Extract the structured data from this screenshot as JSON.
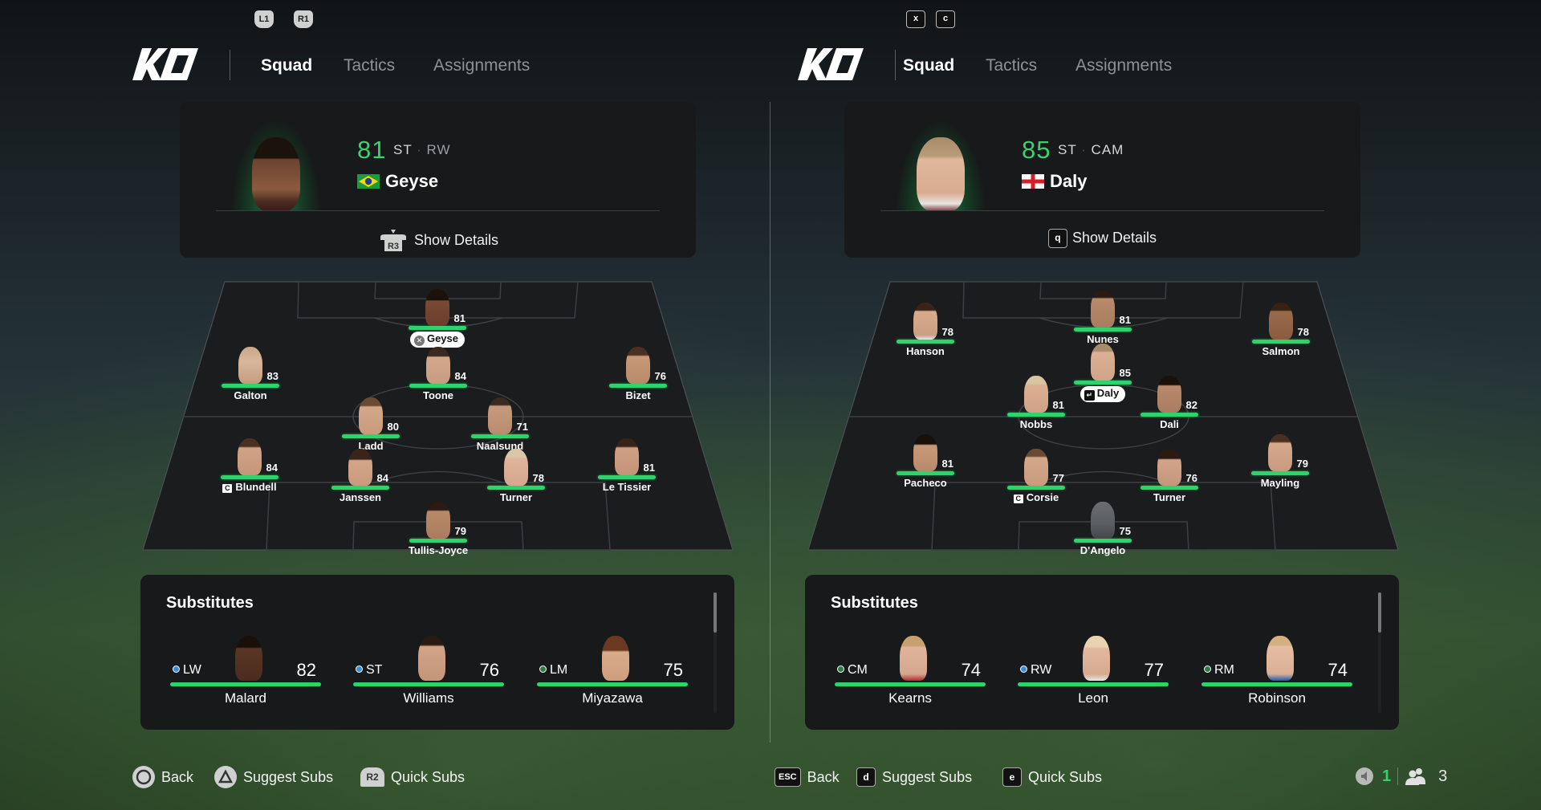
{
  "colors": {
    "accent_green": "#2ed36b",
    "rating_green": "#3bd16f",
    "panel_bg": "#17191a",
    "pitch_bg": "#1a1c1d",
    "dot_blue": "#3a8fd6",
    "dot_green": "#2f7d45"
  },
  "left": {
    "shoulder_buttons": [
      "L1",
      "R1"
    ],
    "logo": "KO",
    "tabs": [
      {
        "label": "Squad",
        "active": true
      },
      {
        "label": "Tactics",
        "active": false
      },
      {
        "label": "Assignments",
        "active": false
      }
    ],
    "selected_player": {
      "rating": "81",
      "positions": [
        "ST",
        "RW"
      ],
      "flag": "brazil-flag",
      "name": "Geyse",
      "details_button_icon": "R3",
      "details_label": "Show Details"
    },
    "pitch_players": [
      {
        "name": "Geyse",
        "rating": "81",
        "selected": true,
        "pill_icon": "cross-button-icon"
      },
      {
        "name": "Galton",
        "rating": "83"
      },
      {
        "name": "Toone",
        "rating": "84"
      },
      {
        "name": "Bizet",
        "rating": "76"
      },
      {
        "name": "Ladd",
        "rating": "80"
      },
      {
        "name": "Naalsund",
        "rating": "71"
      },
      {
        "name": "Blundell",
        "rating": "84",
        "captain": true
      },
      {
        "name": "Janssen",
        "rating": "84"
      },
      {
        "name": "Turner",
        "rating": "78"
      },
      {
        "name": "Le Tissier",
        "rating": "81"
      },
      {
        "name": "Tullis-Joyce",
        "rating": "79"
      }
    ],
    "captain_badge": "C",
    "substitutes": {
      "title": "Substitutes",
      "players": [
        {
          "position": "LW",
          "dot": "blue",
          "rating": "82",
          "name": "Malard"
        },
        {
          "position": "ST",
          "dot": "blue",
          "rating": "76",
          "name": "Williams"
        },
        {
          "position": "LM",
          "dot": "green",
          "rating": "75",
          "name": "Miyazawa"
        }
      ]
    },
    "hints": [
      {
        "icon": "circle-button-icon",
        "label": "Back"
      },
      {
        "icon": "triangle-button-icon",
        "label": "Suggest Subs"
      },
      {
        "icon": "R2",
        "label": "Quick Subs"
      }
    ]
  },
  "right": {
    "key_buttons": [
      "x",
      "c"
    ],
    "logo": "KO",
    "tabs": [
      {
        "label": "Squad",
        "active": true
      },
      {
        "label": "Tactics",
        "active": false
      },
      {
        "label": "Assignments",
        "active": false
      }
    ],
    "selected_player": {
      "rating": "85",
      "positions": [
        "ST",
        "CAM"
      ],
      "flag": "england-flag",
      "name": "Daly",
      "details_button_icon": "q",
      "details_label": "Show Details"
    },
    "pitch_players": [
      {
        "name": "Hanson",
        "rating": "78"
      },
      {
        "name": "Nunes",
        "rating": "81"
      },
      {
        "name": "Salmon",
        "rating": "78"
      },
      {
        "name": "Daly",
        "rating": "85",
        "selected": true,
        "pill_icon": "enter-key-icon"
      },
      {
        "name": "Nobbs",
        "rating": "81"
      },
      {
        "name": "Dali",
        "rating": "82"
      },
      {
        "name": "Pacheco",
        "rating": "81"
      },
      {
        "name": "Corsie",
        "rating": "77",
        "captain": true
      },
      {
        "name": "Turner",
        "rating": "76"
      },
      {
        "name": "Mayling",
        "rating": "79"
      },
      {
        "name": "D'Angelo",
        "rating": "75"
      }
    ],
    "captain_badge": "C",
    "substitutes": {
      "title": "Substitutes",
      "players": [
        {
          "position": "CM",
          "dot": "green",
          "rating": "74",
          "name": "Kearns"
        },
        {
          "position": "RW",
          "dot": "blue",
          "rating": "77",
          "name": "Leon"
        },
        {
          "position": "RM",
          "dot": "green",
          "rating": "74",
          "name": "Robinson"
        }
      ]
    },
    "hints": [
      {
        "icon": "ESC",
        "label": "Back"
      },
      {
        "icon": "d",
        "label": "Suggest Subs"
      },
      {
        "icon": "e",
        "label": "Quick Subs"
      }
    ]
  },
  "status": {
    "voice_count": "1",
    "players_count": "3"
  }
}
